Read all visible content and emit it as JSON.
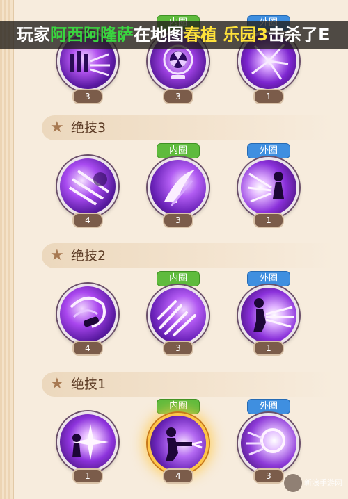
{
  "ticker": {
    "seg1": "玩家",
    "seg2": "阿西阿隆萨",
    "seg3": "在地图",
    "seg4": "春植 乐园3",
    "seg5": "击杀了",
    "seg6": "E"
  },
  "top_row": {
    "skills": [
      {
        "tag": null,
        "level": "3",
        "icon": "dash-lines-skill-icon"
      },
      {
        "tag": "内圈",
        "tag_type": "inner",
        "level": "3",
        "icon": "radiation-target-skill-icon"
      },
      {
        "tag": "外圈",
        "tag_type": "outer",
        "level": "1",
        "icon": "burst-skill-icon"
      }
    ]
  },
  "sections": [
    {
      "title": "绝技3",
      "skills": [
        {
          "tag": null,
          "level": "4",
          "icon": "slash-lines-skill-icon"
        },
        {
          "tag": "内圈",
          "tag_type": "inner",
          "level": "3",
          "icon": "crescent-strike-skill-icon"
        },
        {
          "tag": "外圈",
          "tag_type": "outer",
          "level": "1",
          "icon": "silhouette-blast-skill-icon"
        }
      ]
    },
    {
      "title": "绝技2",
      "skills": [
        {
          "tag": null,
          "level": "4",
          "icon": "vortex-swirl-skill-icon"
        },
        {
          "tag": "内圈",
          "tag_type": "inner",
          "level": "3",
          "icon": "meteor-streaks-skill-icon"
        },
        {
          "tag": "外圈",
          "tag_type": "outer",
          "level": "1",
          "icon": "silhouette-beam-skill-icon"
        }
      ]
    },
    {
      "title": "绝技1",
      "skills": [
        {
          "tag": null,
          "level": "1",
          "icon": "starburst-skill-icon"
        },
        {
          "tag": "内圈",
          "tag_type": "inner",
          "level": "4",
          "icon": "gunner-skill-icon",
          "highlighted": true
        },
        {
          "tag": "外圈",
          "tag_type": "outer",
          "level": "3",
          "icon": "energy-sphere-skill-icon"
        }
      ]
    }
  ],
  "colors": {
    "panel_bg": "#f7ecdd",
    "inner_tag": "#5fbb3d",
    "outer_tag": "#3f8fe0",
    "level_pill": "#7b5c4a",
    "section_title": "#5b3a24",
    "ticker_green": "#39d63f",
    "ticker_yellow": "#ffe23a"
  },
  "watermark": {
    "label": "新浪手游网"
  }
}
